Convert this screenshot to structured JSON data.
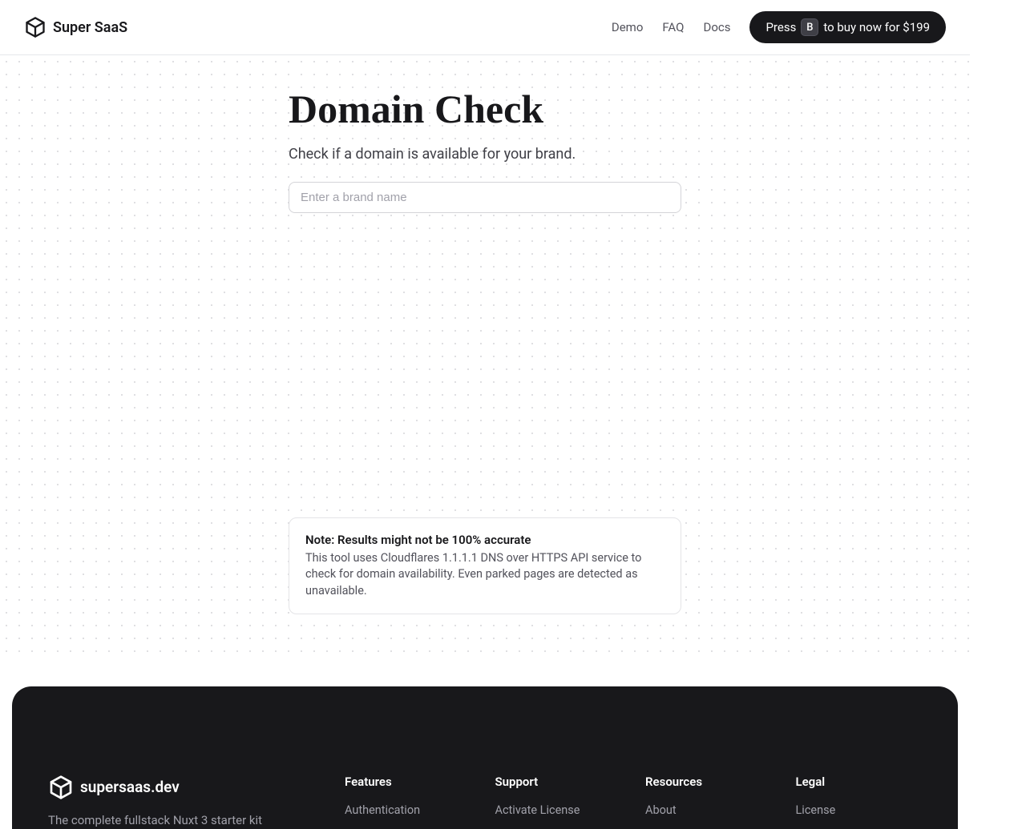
{
  "header": {
    "brand": "Super SaaS",
    "nav": {
      "demo": "Demo",
      "faq": "FAQ",
      "docs": "Docs"
    },
    "buy": {
      "prefix": "Press",
      "key": "B",
      "suffix": "to buy now for $199"
    }
  },
  "main": {
    "title": "Domain Check",
    "subtitle": "Check if a domain is available for your brand.",
    "input_placeholder": "Enter a brand name",
    "note": {
      "title": "Note: Results might not be 100% accurate",
      "body": "This tool uses Cloudflares 1.1.1.1 DNS over HTTPS API service to check for domain availability. Even parked pages are detected as unavailable."
    }
  },
  "footer": {
    "brand": "supersaas.dev",
    "tagline": "The complete fullstack Nuxt 3 starter kit",
    "columns": [
      {
        "title": "Features",
        "links": [
          "Authentication"
        ]
      },
      {
        "title": "Support",
        "links": [
          "Activate License"
        ]
      },
      {
        "title": "Resources",
        "links": [
          "About"
        ]
      },
      {
        "title": "Legal",
        "links": [
          "License"
        ]
      }
    ]
  }
}
